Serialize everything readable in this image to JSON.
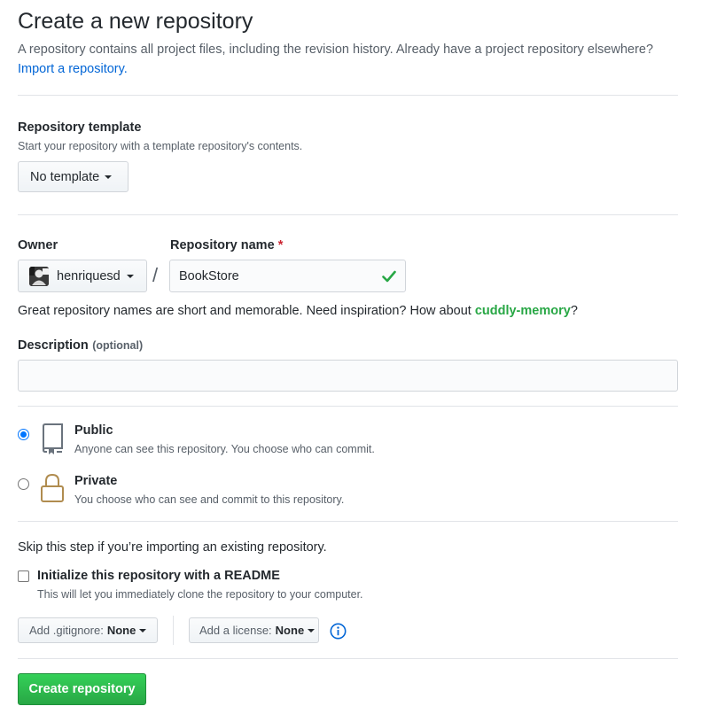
{
  "header": {
    "title": "Create a new repository",
    "lead": "A repository contains all project files, including the revision history. Already have a project repository elsewhere?",
    "import_link": "Import a repository."
  },
  "template": {
    "label": "Repository template",
    "note": "Start your repository with a template repository's contents.",
    "button_label": "No template"
  },
  "owner": {
    "label": "Owner",
    "value": "henriquesd"
  },
  "repo_name": {
    "label": "Repository name",
    "required_mark": "*",
    "value": "BookStore",
    "separator": "/"
  },
  "suggestion": {
    "prefix": "Great repository names are short and memorable. Need inspiration? How about",
    "name": "cuddly-memory",
    "suffix": "?"
  },
  "description": {
    "label": "Description",
    "optional": "(optional)",
    "value": ""
  },
  "visibility": {
    "public": {
      "title": "Public",
      "desc": "Anyone can see this repository. You choose who can commit.",
      "checked": true,
      "icon": "repo-icon"
    },
    "private": {
      "title": "Private",
      "desc": "You choose who can see and commit to this repository.",
      "checked": false,
      "icon": "lock-icon"
    }
  },
  "init": {
    "skip_text": "Skip this step if you’re importing an existing repository.",
    "readme_label": "Initialize this repository with a README",
    "readme_note": "This will let you immediately clone the repository to your computer.",
    "readme_checked": false,
    "gitignore_prefix": "Add .gitignore:",
    "gitignore_value": "None",
    "license_prefix": "Add a license:",
    "license_value": "None"
  },
  "submit": {
    "label": "Create repository"
  },
  "colors": {
    "link": "#0366d6",
    "success": "#28a745",
    "required": "#cb2431",
    "radio_accent": "#0075ff",
    "lock_icon": "#b08c4f"
  }
}
